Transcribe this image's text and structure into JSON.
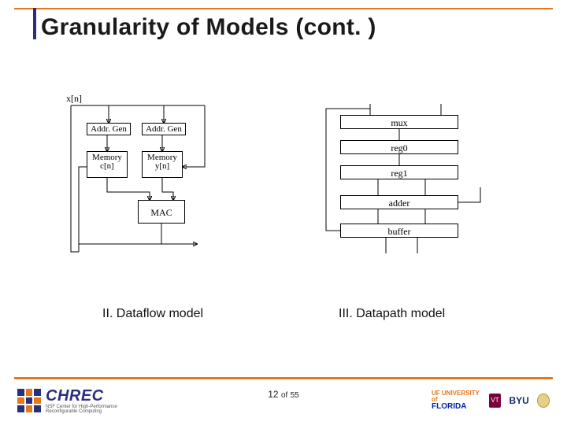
{
  "title": "Granularity of Models (cont. )",
  "left": {
    "caption": "II.  Dataflow model",
    "input_label": "x[n]",
    "addrgen1": "Addr. Gen",
    "addrgen2": "Addr. Gen",
    "mem1_line1": "Memory",
    "mem1_line2": "c[n]",
    "mem2_line1": "Memory",
    "mem2_line2": "y[n]",
    "mac": "MAC"
  },
  "right": {
    "caption": "III.  Datapath model",
    "mux": "mux",
    "reg0": "reg0",
    "reg1": "reg1",
    "adder": "adder",
    "buffer": "buffer"
  },
  "footer": {
    "page": "12",
    "of_label": "of",
    "total": "55"
  },
  "logos": {
    "chrec": "CHREC",
    "chrec_sub": "NSF Center for High-Performance Reconfigurable Computing",
    "uf_top": "UF UNIVERSITY of",
    "uf_bottom": "FLORIDA",
    "vt": "VT",
    "byu": "BYU"
  },
  "colors": {
    "accent": "#e67817",
    "primary": "#2b2e7b"
  }
}
